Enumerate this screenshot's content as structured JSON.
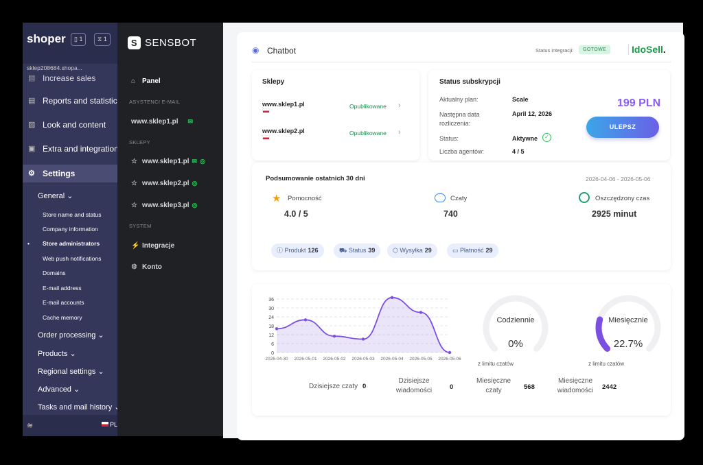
{
  "shoper": {
    "logo": "shoper",
    "badges": [
      "1",
      "1"
    ],
    "shop": "sklep208684.shopa...",
    "nav": [
      "Increase sales",
      "Reports and statistics",
      "Look and content",
      "Extra and integrations",
      "Settings"
    ],
    "general": "General",
    "sub": [
      "Store name and status",
      "Company information",
      "Store administrators",
      "Web push notifications",
      "Domains",
      "E-mail address",
      "E-mail accounts",
      "Cache memory"
    ],
    "groups": [
      "Order processing",
      "Products",
      "Regional settings",
      "Advanced",
      "Tasks and mail history"
    ],
    "lang": "PL"
  },
  "sensbot": {
    "brand": "SENSBOT",
    "panel": "Panel",
    "sec_assist": "ASYSTENCI E-MAIL",
    "assist": "www.sklep1.pl",
    "sec_shops": "SKLEPY",
    "shops": [
      "www.sklep1.pl",
      "www.sklep2.pl",
      "www.sklep3.pl"
    ],
    "sec_system": "SYSTEM",
    "integrations": "Integracje",
    "account": "Konto"
  },
  "header": {
    "title": "Chatbot",
    "status_label": "Status integracji:",
    "status_value": "GOTOWE",
    "partner": "IdoSell"
  },
  "shops_panel": {
    "title": "Sklepy",
    "rows": [
      {
        "name": "www.sklep1.pl",
        "status": "Opublikowane"
      },
      {
        "name": "www.sklep2.pl",
        "status": "Opublikowane"
      }
    ]
  },
  "subscription": {
    "title": "Status subskrypcji",
    "plan_label": "Aktualny plan:",
    "plan": "Scale",
    "next_label": "Następna data rozliczenia:",
    "next": "April 12, 2026",
    "status_label": "Status:",
    "status": "Aktywne",
    "agents_label": "Liczba agentów:",
    "agents": "4 / 5",
    "price": "199 PLN",
    "upgrade": "ULEPSZ"
  },
  "summary": {
    "title": "Podsumowanie ostatnich 30 dni",
    "range": "2026-04-06 - 2026-05-06",
    "help_label": "Pomocność",
    "help": "4.0 / 5",
    "chats_label": "Czaty",
    "chats": "740",
    "saved_label": "Oszczędzony czas",
    "saved": "2925 minut",
    "tags": [
      {
        "label": "Produkt",
        "count": "126"
      },
      {
        "label": "Status",
        "count": "39"
      },
      {
        "label": "Wysyłka",
        "count": "29"
      },
      {
        "label": "Płatność",
        "count": "29"
      }
    ]
  },
  "chart_data": {
    "type": "area",
    "x": [
      "2026-04-30",
      "2026-05-01",
      "2026-05-02",
      "2026-05-03",
      "2026-05-04",
      "2026-05-05",
      "2026-05-06"
    ],
    "series": [
      {
        "values": [
          16,
          22,
          11,
          9,
          37,
          27,
          0
        ]
      }
    ],
    "yticks": [
      "0",
      "6",
      "12",
      "18",
      "24",
      "30",
      "36"
    ],
    "ylim": [
      0,
      36
    ],
    "color": "#7b4fe0"
  },
  "gauges": [
    {
      "title": "Codziennie",
      "value": "0%",
      "fraction": 0,
      "note": "z limitu czatów"
    },
    {
      "title": "Miesięcznie",
      "value": "22.7%",
      "fraction": 0.227,
      "note": "z limitu czatów"
    }
  ],
  "stats": {
    "today_chats_label": "Dzisiejsze czaty",
    "today_chats": "0",
    "today_msgs_label": "Dzisiejsze wiadomości",
    "today_msgs": "0",
    "month_chats_label": "Miesięczne czaty",
    "month_chats": "568",
    "month_msgs_label": "Miesięczne wiadomości",
    "month_msgs": "2442"
  }
}
